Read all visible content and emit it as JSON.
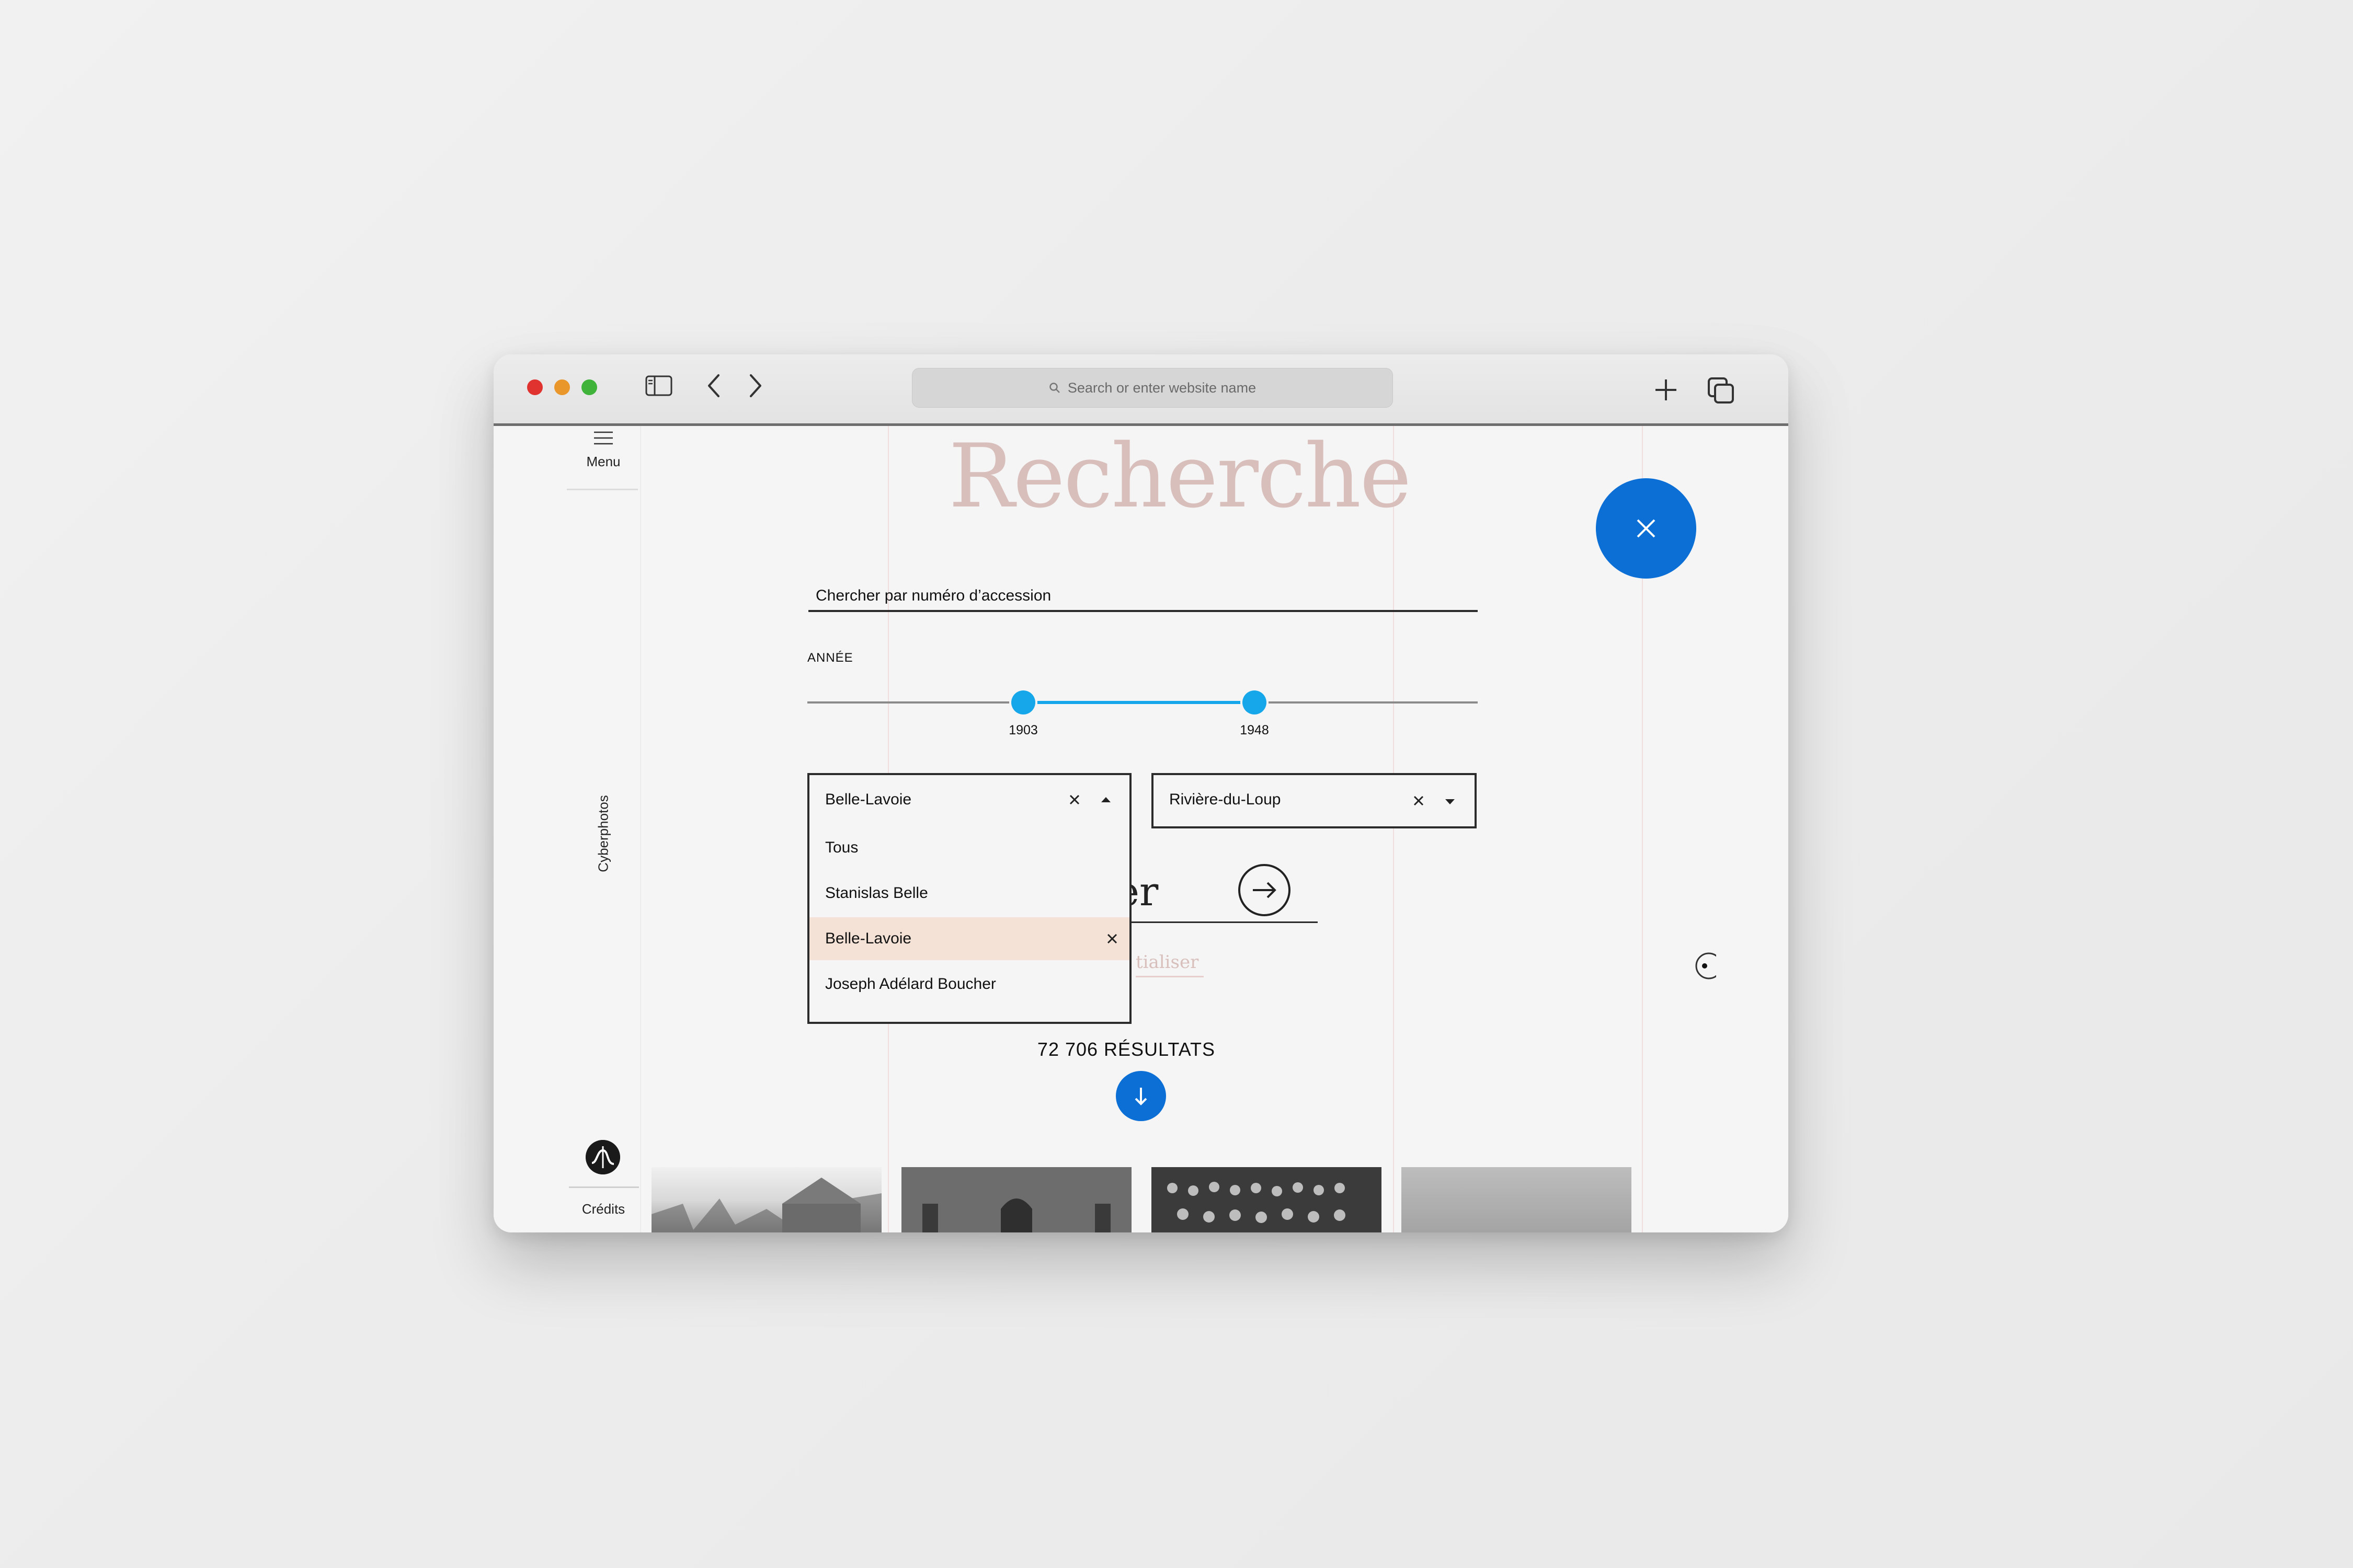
{
  "browser": {
    "url_placeholder": "Search or enter website name"
  },
  "sidebar": {
    "menu_label": "Menu",
    "brand": "Cyberphotos",
    "credits_label": "Crédits"
  },
  "search": {
    "title": "Recherche",
    "accession_placeholder": "Chercher par numéro d’accession",
    "year_label": "ANNÉE",
    "year_min": 1903,
    "year_max": 1948,
    "search_button_fragment": "er",
    "reset_fragment": "tialiser"
  },
  "photographer_select": {
    "selected": "Belle-Lavoie",
    "options": [
      "Tous",
      "Stanislas Belle",
      "Belle-Lavoie",
      "Joseph Adélard Boucher"
    ]
  },
  "place_select": {
    "selected": "Rivière-du-Loup"
  },
  "results": {
    "count_label": "72 706 RÉSULTATS"
  },
  "colors": {
    "accent_blue": "#0b6fd6",
    "slider_blue": "#16a6ea",
    "title_pink": "#d8bfbc",
    "highlight": "#f4e2d6"
  }
}
